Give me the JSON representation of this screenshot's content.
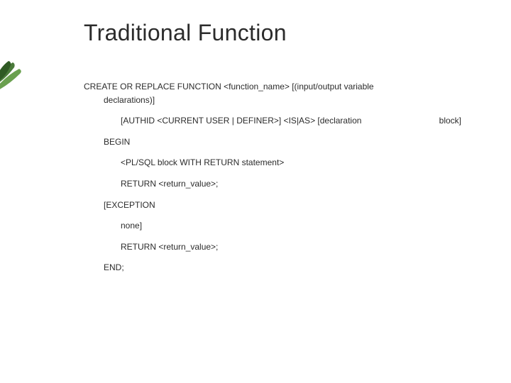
{
  "title": "Traditional Function",
  "code": {
    "l1": "CREATE OR REPLACE FUNCTION <function_name> [(input/output variable declarations)]",
    "l2a": "[AUTHID <CURRENT USER | DEFINER>] <IS|AS> [declaration",
    "l2b": "block]",
    "l3": "BEGIN",
    "l4": "<PL/SQL block WITH RETURN statement>",
    "l5": "RETURN <return_value>;",
    "l6": "[EXCEPTION",
    "l7": "none]",
    "l8": "RETURN <return_value>;",
    "l9": "END;"
  }
}
